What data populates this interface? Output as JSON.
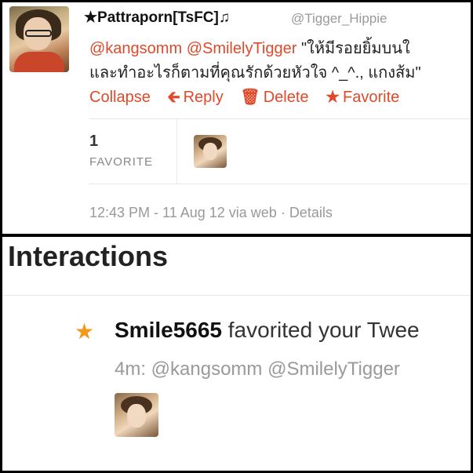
{
  "tweet": {
    "author_name": "★Pattraporn[TsFC]♫",
    "author_handle": "@Tigger_Hippie",
    "mention_1": "@kangsomm",
    "mention_2": "@SmilelyTigger",
    "text_line1": "\"ให้มีรอยยิ้มบนใ",
    "text_line2": "และทำอะไรก็ตามที่คุณรักด้วยหัวใจ ^_^., แกงส้ม\"",
    "actions": {
      "collapse": "Collapse",
      "reply": "Reply",
      "delete": "Delete",
      "favorite": "Favorite"
    },
    "favorite_count": "1",
    "favorite_label": "FAVORITE",
    "timestamp": "12:43 PM - 11 Aug 12 via web · Details"
  },
  "interactions": {
    "title": "Interactions",
    "user": "Smile5665",
    "action_text": "favorited your Twee",
    "detail": "4m: @kangsomm @SmilelyTigger"
  },
  "colors": {
    "link": "#e04a2a",
    "star": "#f39a1c"
  }
}
